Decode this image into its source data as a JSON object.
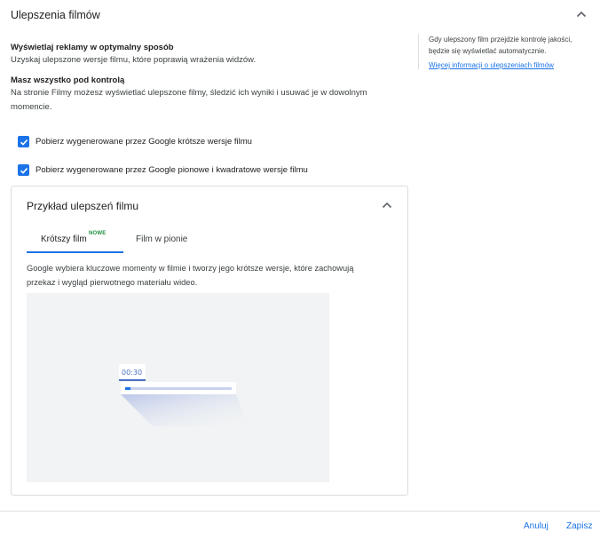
{
  "header": {
    "title": "Ulepszenia filmów"
  },
  "intro": {
    "heading1": "Wyświetlaj reklamy w optymalny sposób",
    "text1": "Uzyskaj ulepszone wersje filmu, które poprawią wrażenia widzów.",
    "heading2": "Masz wszystko pod kontrolą",
    "text2_line1": "Na stronie Filmy możesz wyświetlać ulepszone filmy, śledzić ich wyniki i usuwać je w dowolnym",
    "text2_line2": "momencie."
  },
  "side": {
    "line1": "Gdy ulepszony film przejdzie kontrolę jakości,",
    "line2": "będzie się wyświetlać automatycznie.",
    "link": "Więcej informacji o ulepszeniach filmów"
  },
  "options": [
    {
      "label": "Pobierz wygenerowane przez Google krótsze wersje filmu",
      "checked": true
    },
    {
      "label": "Pobierz wygenerowane przez Google pionowe i kwadratowe wersje filmu",
      "checked": true
    }
  ],
  "example": {
    "title": "Przykład ulepszeń filmu",
    "tabs": [
      {
        "label": "Krótszy film",
        "badge": "NOWE",
        "selected": true
      },
      {
        "label": "Film w pionie",
        "selected": false
      }
    ],
    "desc_line1": "Google wybiera kluczowe momenty w filmie i tworzy jego krótsze wersje, które zachowują",
    "desc_line2": "przekaz i wygląd pierwotnego materiału wideo.",
    "timestamp": "00:30"
  },
  "footer": {
    "cancel": "Anuluj",
    "save": "Zapisz"
  },
  "colors": {
    "accent": "#1a73e8",
    "badge": "#1e8e3e"
  },
  "icons": [
    "chevron-up-icon",
    "checkmark-icon"
  ]
}
